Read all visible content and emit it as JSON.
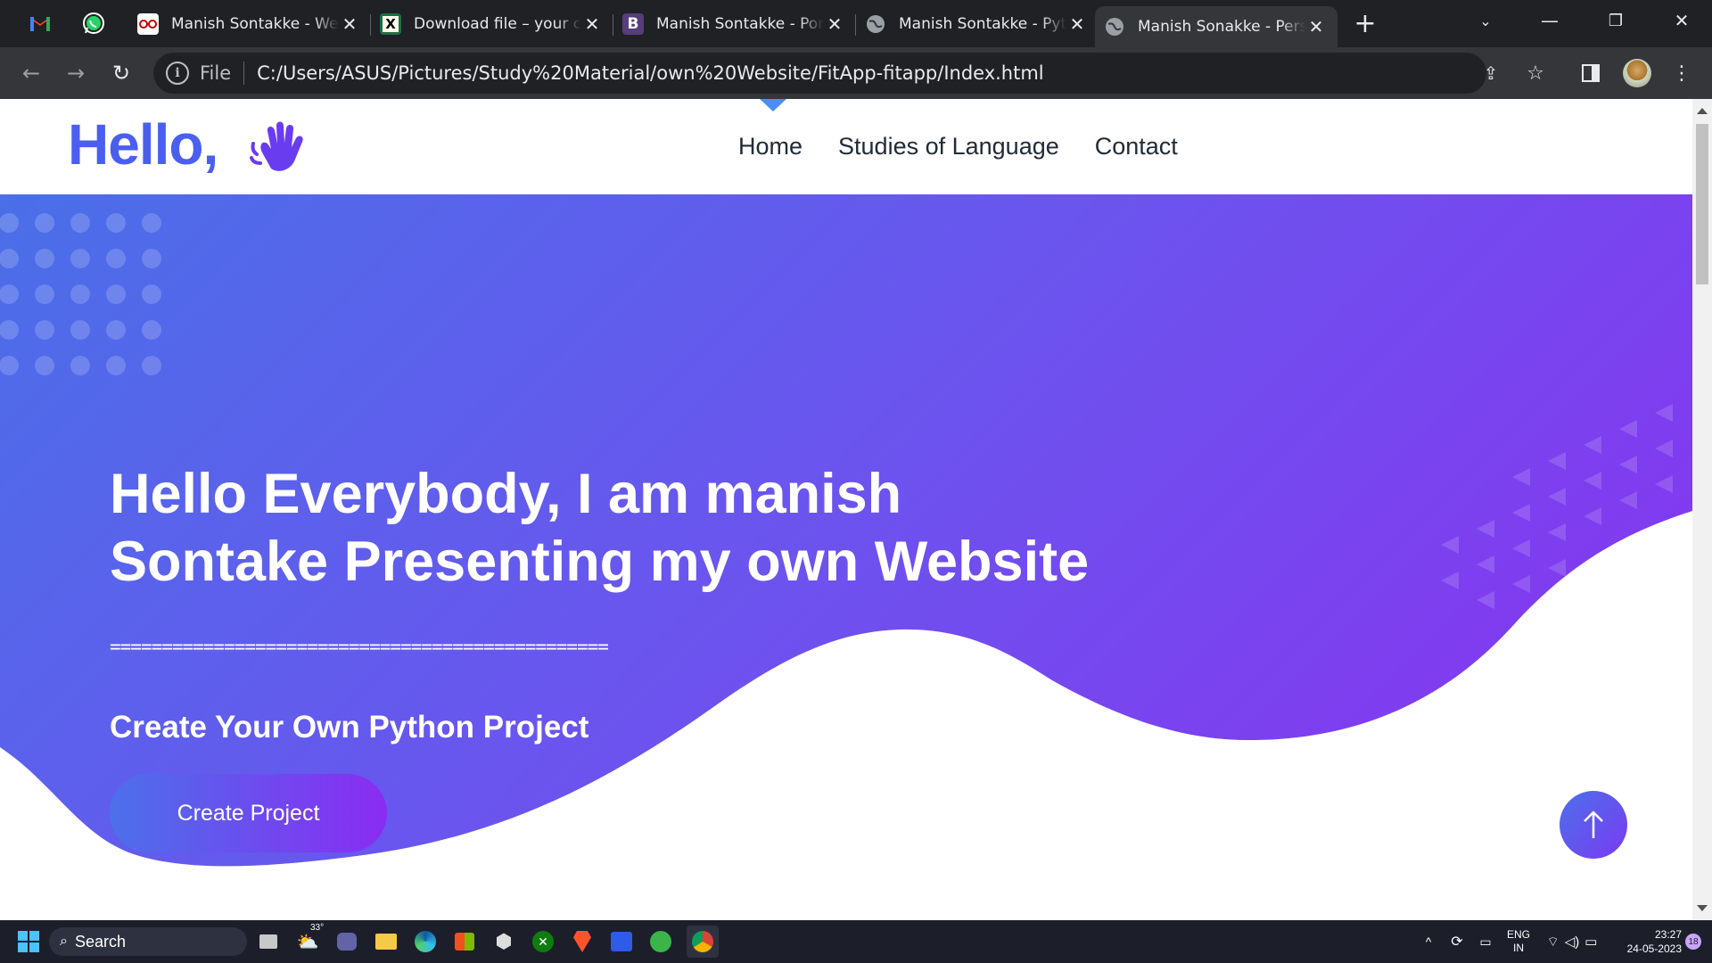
{
  "browser": {
    "tabs": [
      {
        "title": "Manish Sontakke - Web",
        "icon": "glasses-icon"
      },
      {
        "title": "Download file – your c",
        "icon": "excel-icon"
      },
      {
        "title": "Manish Sontakke - Port",
        "icon": "bootstrap-icon"
      },
      {
        "title": "Manish Sontakke - Pyth",
        "icon": "globe-icon"
      },
      {
        "title": "Manish Sonakke - Pers",
        "icon": "globe-icon",
        "active": true
      }
    ],
    "pinned": [
      "gmail-icon",
      "whatsapp-icon"
    ],
    "address": {
      "scheme_label": "File",
      "url": "C:/Users/ASUS/Pictures/Study%20Material/own%20Website/FitApp-fitapp/Index.html"
    }
  },
  "site": {
    "logo_text": "Hello,",
    "nav": [
      {
        "label": "Home",
        "active": true
      },
      {
        "label": "Studies of Language"
      },
      {
        "label": "Contact"
      }
    ],
    "hero": {
      "title": "Hello Everybody, I am manish Sontake Presenting my own Website",
      "rule": "================================================",
      "subtitle": "Create Your Own Python Project",
      "button": "Create Project"
    },
    "colors": {
      "brand": "#4a5ff0",
      "gradient_start": "#4a6fe8",
      "gradient_end": "#8b2ff0"
    }
  },
  "taskbar": {
    "search_placeholder": "Search",
    "weather_temp": "33°",
    "lang_top": "ENG",
    "lang_bottom": "IN",
    "time": "23:27",
    "date": "24-05-2023",
    "notification_count": "18"
  }
}
